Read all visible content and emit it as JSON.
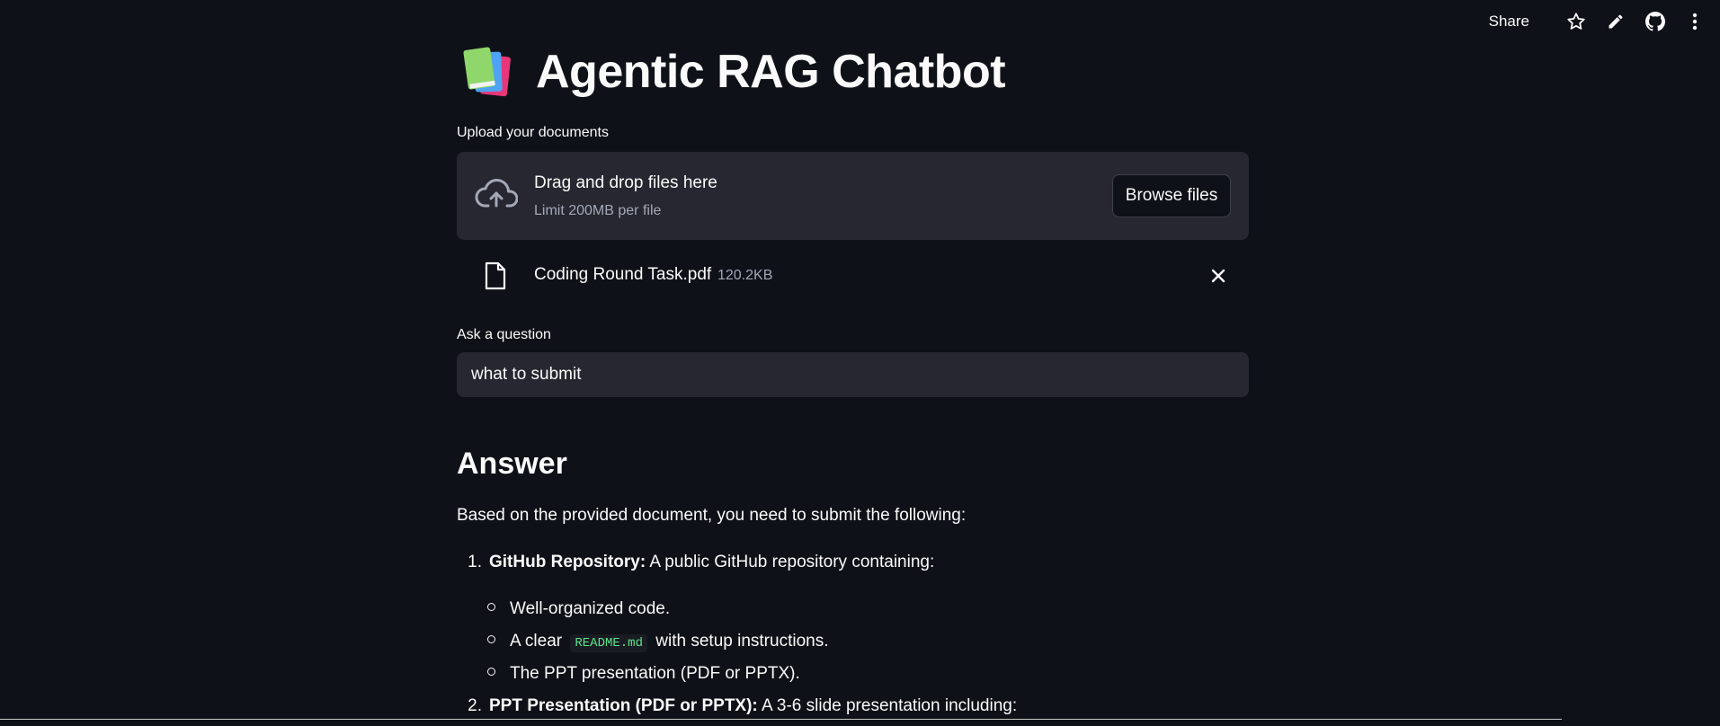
{
  "toolbar": {
    "share_label": "Share",
    "icons": [
      "star-icon",
      "edit-pencil-icon",
      "github-icon",
      "more-vertical-icon"
    ]
  },
  "app": {
    "title": "Agentic RAG Chatbot",
    "title_emoji": "books-icon"
  },
  "uploader": {
    "label": "Upload your documents",
    "drag_text": "Drag and drop files here",
    "limit_text": "Limit 200MB per file",
    "browse_label": "Browse files",
    "file": {
      "name": "Coding Round Task.pdf",
      "size": "120.2KB"
    }
  },
  "question": {
    "label": "Ask a question",
    "value": "what to submit"
  },
  "answer": {
    "heading": "Answer",
    "intro": "Based on the provided document, you need to submit the following:",
    "item1": {
      "num": "1.",
      "bold": "GitHub Repository:",
      "rest": " A public GitHub repository containing:",
      "bullets": {
        "b1": "Well-organized code.",
        "b2_pre": "A clear",
        "b2_code": "README.md",
        "b2_post": "with setup instructions.",
        "b3": "The PPT presentation (PDF or PPTX)."
      }
    },
    "item2": {
      "num": "2.",
      "bold": "PPT Presentation (PDF or PPTX):",
      "rest": " A 3-6 slide presentation including:"
    }
  },
  "colors": {
    "background": "#0e1117",
    "panel": "#262730",
    "text": "#fafafa",
    "muted": "#a3a8b8",
    "code": "#5ce488"
  }
}
